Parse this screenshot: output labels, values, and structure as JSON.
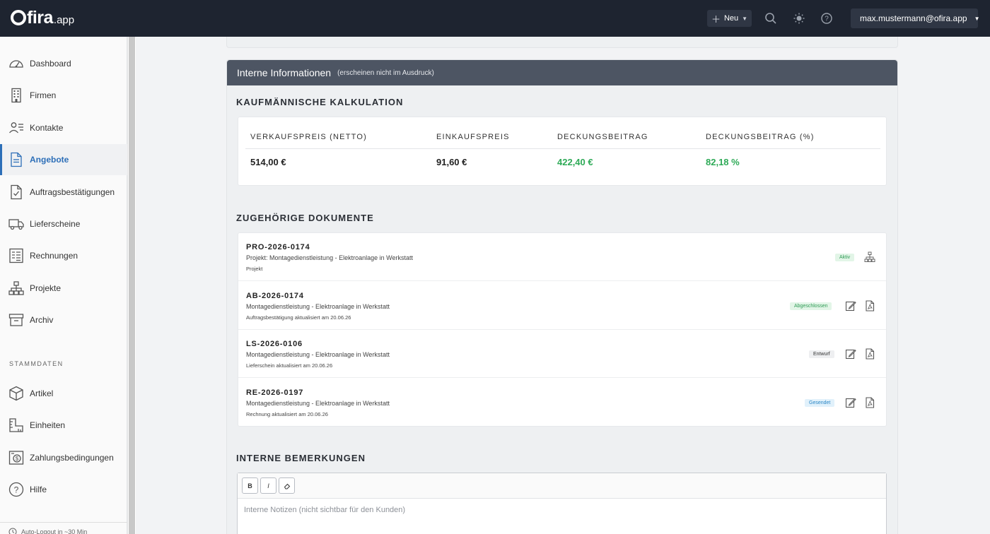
{
  "app": {
    "logo_text": "fira",
    "logo_suffix": ".app",
    "new_button": "Neu",
    "user": "max.mustermann@ofira.app"
  },
  "sidebar": {
    "items": [
      {
        "label": "Dashboard",
        "icon": "dashboard-icon"
      },
      {
        "label": "Firmen",
        "icon": "building-icon"
      },
      {
        "label": "Kontakte",
        "icon": "contacts-icon"
      },
      {
        "label": "Angebote",
        "icon": "document-icon",
        "active": true
      },
      {
        "label": "Auftragsbestätigungen",
        "icon": "document-check-icon"
      },
      {
        "label": "Lieferscheine",
        "icon": "truck-icon"
      },
      {
        "label": "Rechnungen",
        "icon": "invoice-icon"
      },
      {
        "label": "Projekte",
        "icon": "hierarchy-icon"
      },
      {
        "label": "Archiv",
        "icon": "archive-icon"
      }
    ],
    "section_label": "STAMMDATEN",
    "master_items": [
      {
        "label": "Artikel",
        "icon": "box-icon"
      },
      {
        "label": "Einheiten",
        "icon": "ruler-icon"
      },
      {
        "label": "Zahlungsbedingungen",
        "icon": "payment-icon"
      },
      {
        "label": "Hilfe",
        "icon": "help-icon"
      }
    ],
    "footer": "Auto-Logout in ~30 Min"
  },
  "panel": {
    "title": "Interne Informationen",
    "subtitle": "(erscheinen nicht im Ausdruck)"
  },
  "calculation": {
    "title": "KAUFMÄNNISCHE KALKULATION",
    "headers": [
      "VERKAUFSPREIS (NETTO)",
      "EINKAUFSPREIS",
      "DECKUNGSBEITRAG",
      "DECKUNGSBEITRAG (%)"
    ],
    "values": [
      "514,00 €",
      "91,60 €",
      "422,40 €",
      "82,18 %"
    ]
  },
  "documents": {
    "title": "ZUGEHÖRIGE DOKUMENTE",
    "rows": [
      {
        "code": "PRO-2026-0174",
        "desc": "Projekt: Montagedienstleistung - Elektroanlage in Werkstatt",
        "meta": "Projekt",
        "status": "Aktiv"
      },
      {
        "code": "AB-2026-0174",
        "desc": "Montagedienstleistung - Elektroanlage in Werkstatt",
        "meta": "Auftragsbestätigung aktualisiert am 20.06.26",
        "status": "Abgeschlossen"
      },
      {
        "code": "LS-2026-0106",
        "desc": "Montagedienstleistung - Elektroanlage in Werkstatt",
        "meta": "Lieferschein aktualisiert am 20.06.26",
        "status": "Entwurf"
      },
      {
        "code": "RE-2026-0197",
        "desc": "Montagedienstleistung - Elektroanlage in Werkstatt",
        "meta": "Rechnung aktualisiert am 20.06.26",
        "status": "Gesendet"
      }
    ]
  },
  "remarks": {
    "title": "INTERNE BEMERKUNGEN",
    "bold": "B",
    "italic": "I",
    "placeholder": "Interne Notizen (nicht sichtbar für den Kunden)"
  },
  "colors": {
    "accent": "#2d6fb8",
    "topbar": "#1e2430",
    "positive": "#2eaa57"
  }
}
